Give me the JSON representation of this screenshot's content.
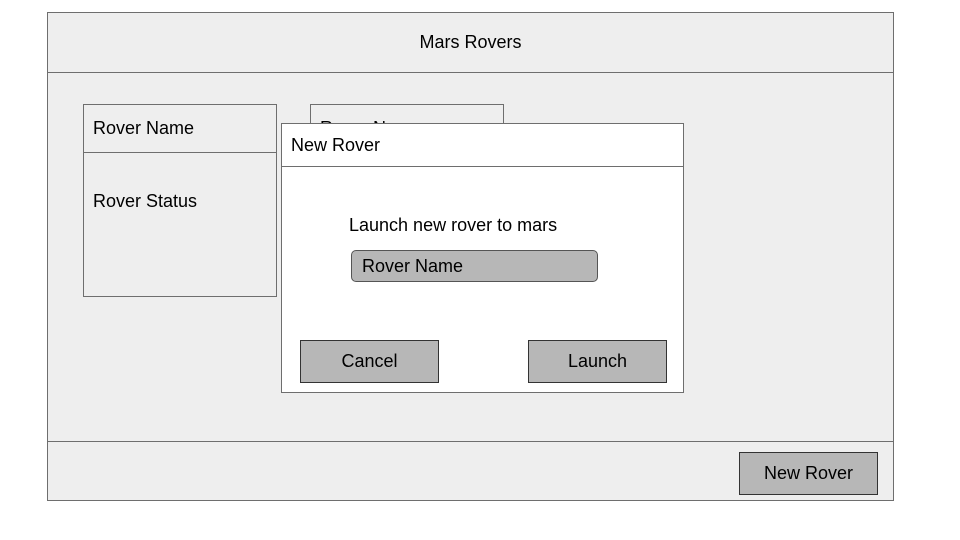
{
  "app": {
    "title": "Mars Rovers",
    "new_rover_button": "New Rover"
  },
  "rover_cards": [
    {
      "name": "Rover Name",
      "status": "Rover Status"
    },
    {
      "name": "Rover Name"
    }
  ],
  "modal": {
    "title": "New Rover",
    "message": "Launch new rover to mars",
    "input_placeholder": "Rover Name",
    "cancel_label": "Cancel",
    "launch_label": "Launch"
  }
}
